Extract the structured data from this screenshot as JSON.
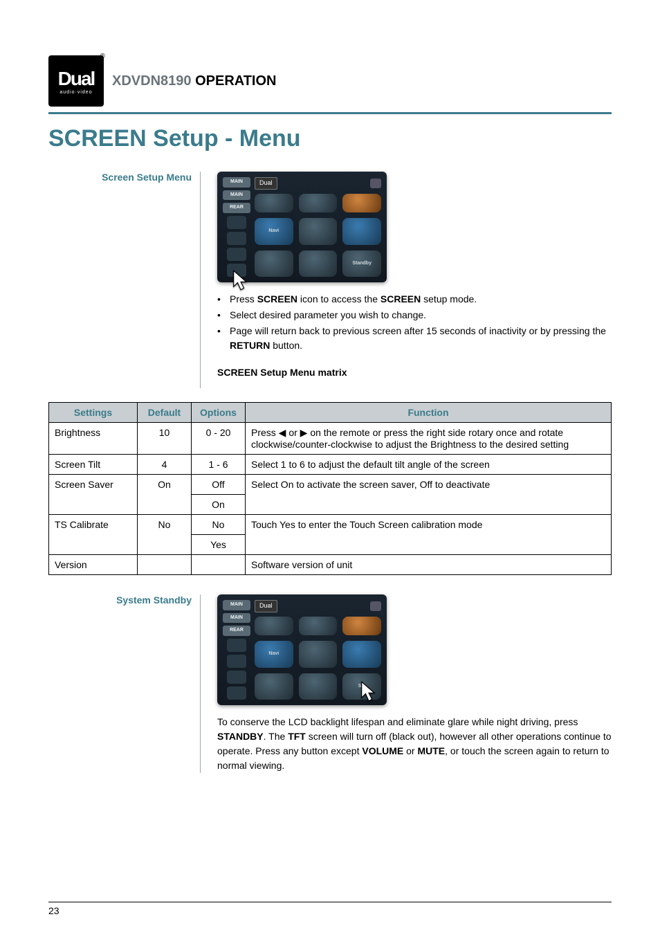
{
  "header": {
    "logo_main": "Dual",
    "logo_sub": "audio·video",
    "model": "XDVDN8190",
    "operation": "OPERATION"
  },
  "page_title": "SCREEN Setup - Menu",
  "section1": {
    "label": "Screen Setup Menu",
    "ss": {
      "tab_main": "MAIN",
      "tab_main2": "MAIN",
      "tab_rear": "REAR",
      "brand": "Dual",
      "btn_navi": "Navi",
      "btn_standby": "Standby"
    },
    "bullets": [
      {
        "pre": "Press ",
        "b1": "SCREEN",
        "mid": " icon to access the ",
        "b2": "SCREEN",
        "post": " setup mode."
      },
      {
        "pre": "Select desired parameter you wish to change.",
        "b1": "",
        "mid": "",
        "b2": "",
        "post": ""
      },
      {
        "pre": "Page will return back to previous screen after 15 seconds of inactivity or by pressing the ",
        "b1": "RETURN",
        "mid": " button.",
        "b2": "",
        "post": ""
      }
    ],
    "matrix_caption_b": "SCREEN",
    "matrix_caption_rest": " Setup Menu matrix"
  },
  "matrix": {
    "headers": {
      "settings": "Settings",
      "default": "Default",
      "options": "Options",
      "function": "Function"
    },
    "rows": [
      {
        "setting": "Brightness",
        "default": "10",
        "options": [
          "0 - 20"
        ],
        "function": "Press ◀ or ▶ on the remote or press the right side rotary once and rotate clockwise/counter-clockwise to adjust the Brightness to the desired setting"
      },
      {
        "setting": "Screen Tilt",
        "default": "4",
        "options": [
          "1 - 6"
        ],
        "function": "Select 1 to 6 to adjust the default tilt angle of the screen"
      },
      {
        "setting": "Screen Saver",
        "default": "On",
        "options": [
          "Off",
          "On"
        ],
        "function": "Select On to activate the screen saver, Off to deactivate"
      },
      {
        "setting": "TS Calibrate",
        "default": "No",
        "options": [
          "No",
          "Yes"
        ],
        "function": "Touch Yes to enter the Touch Screen calibration mode"
      },
      {
        "setting": "Version",
        "default": "",
        "options": [
          ""
        ],
        "function": "Software version of unit"
      }
    ]
  },
  "section2": {
    "label": "System Standby",
    "ss": {
      "tab_main": "MAIN",
      "tab_main2": "MAIN",
      "tab_rear": "REAR",
      "brand": "Dual",
      "btn_navi": "Navi",
      "btn_standby": "Sta"
    },
    "body_parts": {
      "p1": "To conserve the LCD backlight lifespan and eliminate glare while night driving, press ",
      "b1": "STANDBY",
      "p2": ". The ",
      "b2": "TFT",
      "p3": " screen will turn off (black out), however all other operations continue to operate. Press any button except ",
      "b3": "VOLUME",
      "p4": " or ",
      "b4": "MUTE",
      "p5": ", or touch the screen again to return to normal viewing."
    }
  },
  "page_number": "23"
}
